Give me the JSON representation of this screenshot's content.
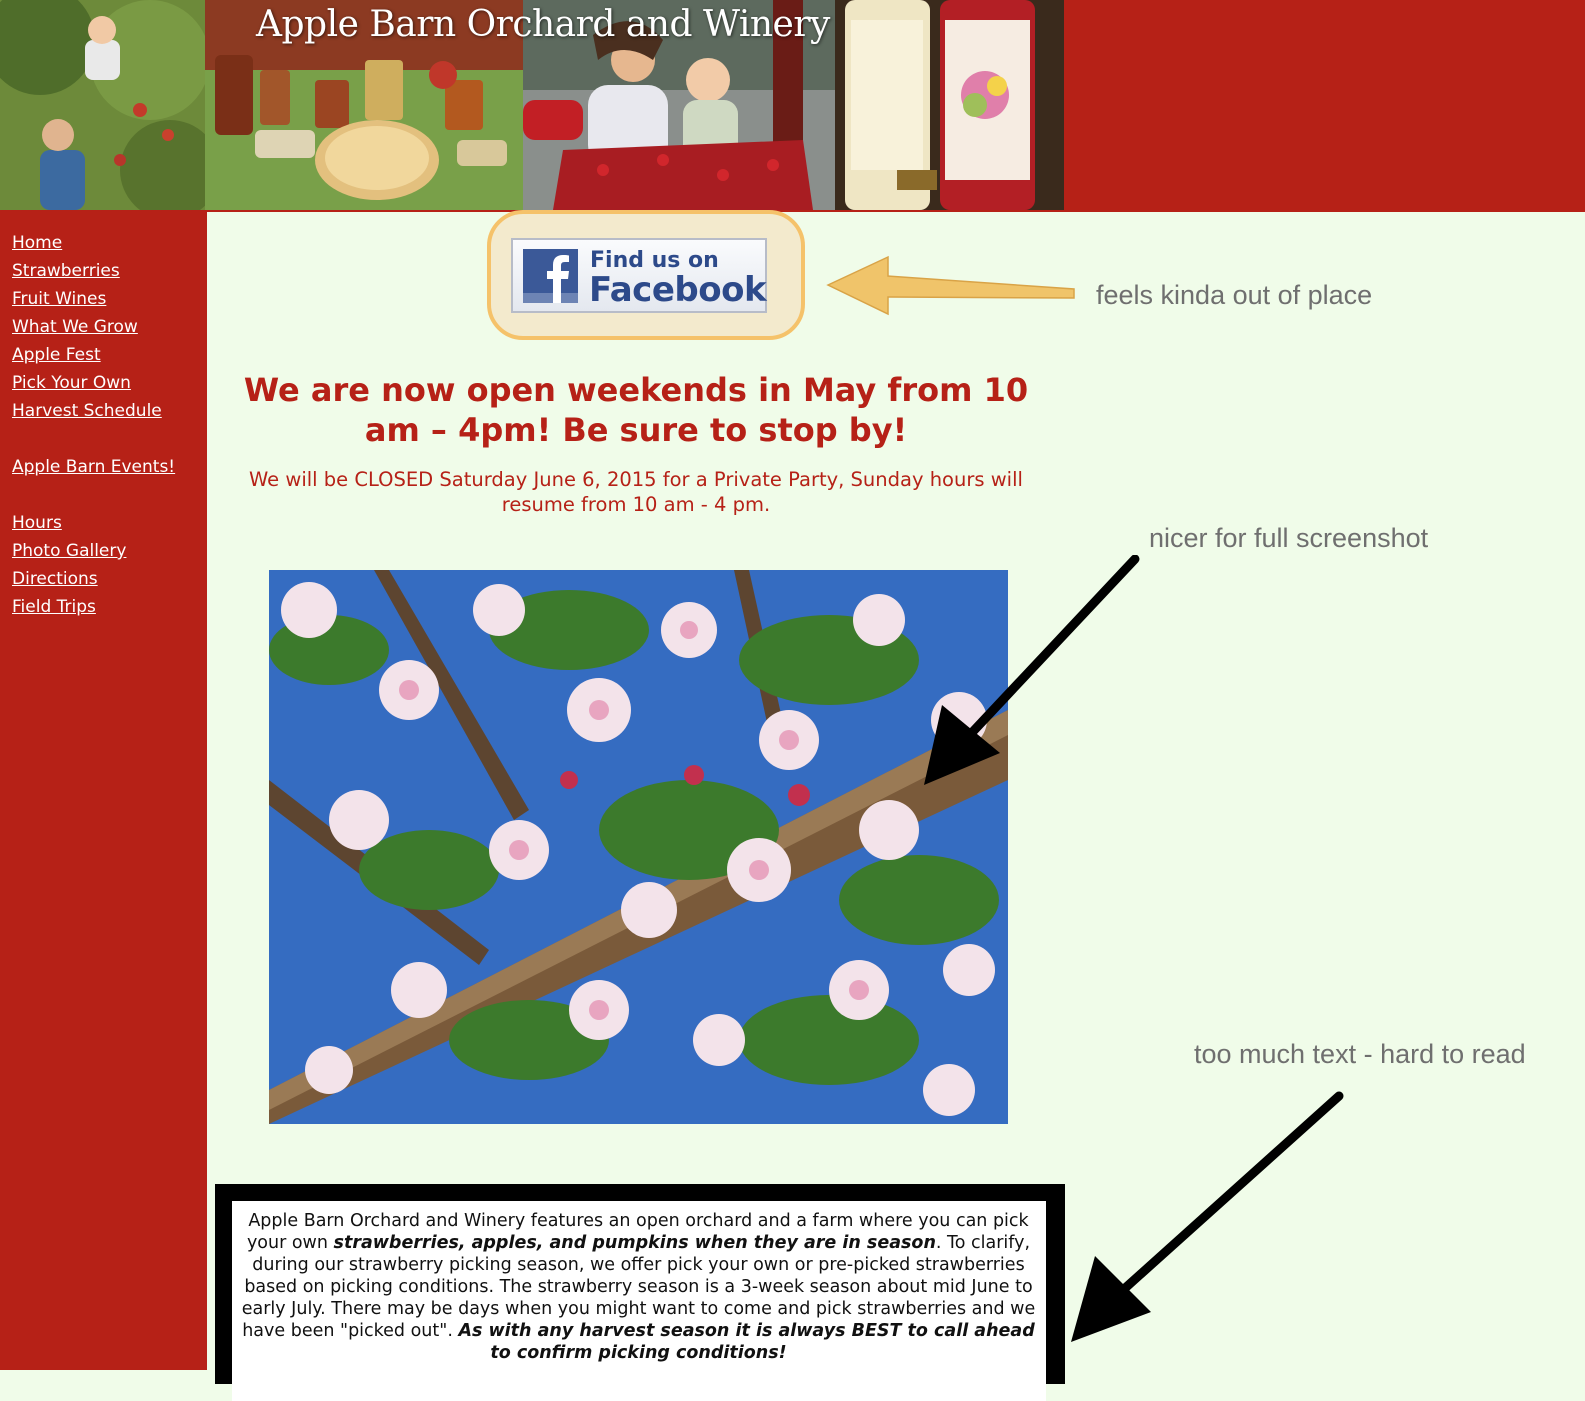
{
  "header": {
    "title": "Apple Barn Orchard and Winery"
  },
  "sidebar": {
    "items": [
      {
        "label": "Home"
      },
      {
        "label": "Strawberries"
      },
      {
        "label": "Fruit Wines"
      },
      {
        "label": "What We Grow"
      },
      {
        "label": "Apple Fest"
      },
      {
        "label": "Pick Your Own"
      },
      {
        "label": "Harvest Schedule"
      },
      {
        "label": "Apple Barn Events!"
      },
      {
        "label": "Hours"
      },
      {
        "label": "Photo Gallery"
      },
      {
        "label": "Directions"
      },
      {
        "label": "Field Trips"
      }
    ]
  },
  "facebook": {
    "line1": "Find us on",
    "line2": "Facebook"
  },
  "main": {
    "headline": "We are now open weekends in May from 10 am – 4pm! Be sure to stop by!",
    "closed_notice": "We will be CLOSED Saturday June 6, 2015 for a Private Party, Sunday hours will resume from 10 am - 4 pm.",
    "intro": {
      "p1": "Apple Barn Orchard and Winery features an open orchard and a farm where you can pick your own ",
      "b1": "strawberries, apples, and pumpkins when they are in season",
      "p2": ". To clarify, during our strawberry picking season, we offer pick your own or pre-picked strawberries based on picking conditions. The strawberry season is a 3-week season about mid June to early July. There may be days when you might want to come and pick strawberries and we have been \"picked out\". ",
      "b2": "As with any harvest season it is always BEST to call ahead to confirm picking conditions!"
    }
  },
  "annotations": {
    "facebook_note": "feels kinda out of place",
    "photo_note": "nicer for full screenshot",
    "text_note": "too much text - hard to read"
  },
  "colors": {
    "brand_red": "#b62117",
    "page_bg": "#f0fce9",
    "highlight": "#f5c26a",
    "facebook_blue": "#3b5998"
  }
}
